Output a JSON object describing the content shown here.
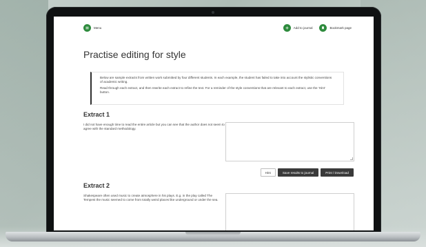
{
  "topbar": {
    "menu_label": "Menu",
    "add_journal_label": "Add to journal",
    "bookmark_label": "Bookmark page"
  },
  "page": {
    "title": "Practise editing for style",
    "intro": [
      "Below are sample extracts from written work submitted by four different students. In each example, the student has failed to take into account the stylistic conventions of academic writing.",
      "Read through each extract, and then rewrite each extract to refine the text. For a reminder of the style conventions that are relevant to each extract, use the 'Hint' button."
    ]
  },
  "extracts": [
    {
      "heading": "Extract 1",
      "text": "I did not have enough time to read the entire article but you can see that the author does not seem to agree with the standard methodology."
    },
    {
      "heading": "Extract 2",
      "text": "Shakespeare often used music to create atmosphere in his plays. E.g. in the play called The Tempest the music seemed to come from totally weird places like underground or under the sea."
    }
  ],
  "buttons": {
    "hint": "Hint",
    "save": "Save results to journal",
    "print": "Print / Download"
  },
  "colors": {
    "accent_green": "#2e8b3d",
    "dark_button": "#3a3a3a"
  },
  "icons": {
    "menu": "menu-icon",
    "journal": "plus-icon",
    "bookmark": "bookmark-icon"
  }
}
